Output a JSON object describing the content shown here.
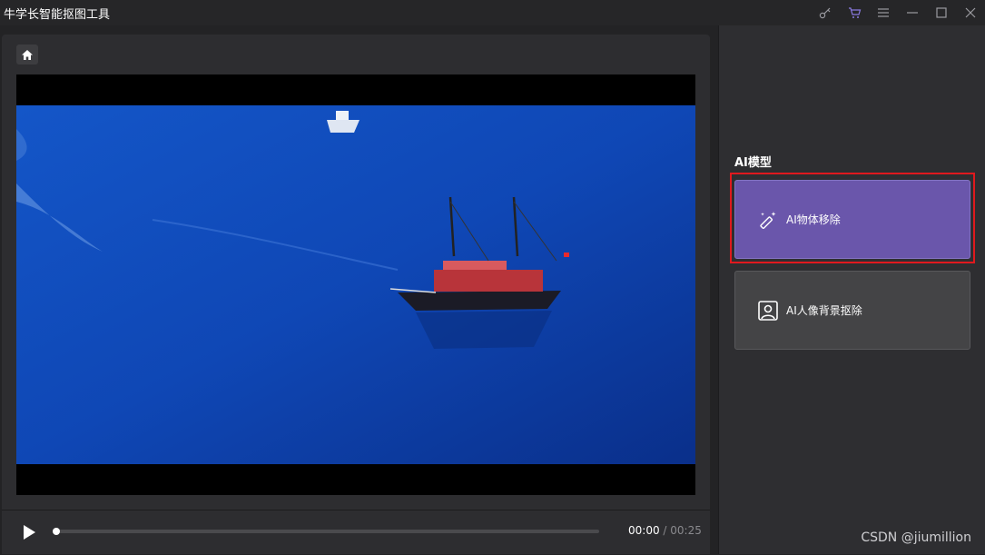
{
  "window": {
    "title": "牛学长智能抠图工具"
  },
  "title_controls": [
    {
      "name": "key-icon",
      "color": "#9a9aa0"
    },
    {
      "name": "cart-icon",
      "color": "#8a7ae0"
    },
    {
      "name": "menu-icon",
      "color": "#9a9aa0"
    },
    {
      "name": "minimize-icon",
      "color": "#9a9aa0"
    },
    {
      "name": "maximize-icon",
      "color": "#9a9aa0"
    },
    {
      "name": "close-icon",
      "color": "#9a9aa0"
    }
  ],
  "player": {
    "home_icon": "home-icon",
    "play_icon": "play-icon",
    "current_time": "00:00",
    "separator": " / ",
    "duration": "00:25",
    "progress": 0
  },
  "sidebar": {
    "section_title": "AI模型",
    "models": [
      {
        "label": "AI物体移除",
        "icon": "magic-wand-icon",
        "selected": true
      },
      {
        "label": "AI人像背景抠除",
        "icon": "portrait-icon",
        "selected": false
      }
    ]
  },
  "colors": {
    "accent": "#6a56ab",
    "highlight_border": "#e0191e"
  },
  "watermark": "CSDN @jiumillion"
}
